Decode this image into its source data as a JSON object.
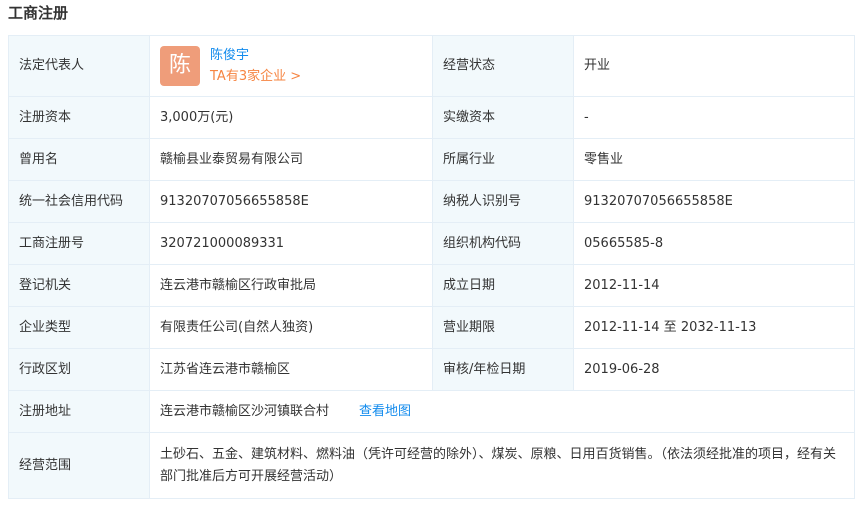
{
  "section": {
    "title": "工商注册"
  },
  "legal_rep": {
    "label": "法定代表人",
    "avatar_char": "陈",
    "name": "陈俊宇",
    "company_count": "TA有3家企业 >"
  },
  "status": {
    "label": "经营状态",
    "value": "开业"
  },
  "rows": [
    {
      "l1": "注册资本",
      "v1": "3,000万(元)",
      "l2": "实缴资本",
      "v2": "-"
    },
    {
      "l1": "曾用名",
      "v1": "赣榆县业泰贸易有限公司",
      "l2": "所属行业",
      "v2": "零售业"
    },
    {
      "l1": "统一社会信用代码",
      "v1": "91320707056655858E",
      "l2": "纳税人识别号",
      "v2": "91320707056655858E"
    },
    {
      "l1": "工商注册号",
      "v1": "320721000089331",
      "l2": "组织机构代码",
      "v2": "05665585-8"
    },
    {
      "l1": "登记机关",
      "v1": "连云港市赣榆区行政审批局",
      "l2": "成立日期",
      "v2": "2012-11-14"
    },
    {
      "l1": "企业类型",
      "v1": "有限责任公司(自然人独资)",
      "l2": "营业期限",
      "v2": "2012-11-14 至 2032-11-13"
    },
    {
      "l1": "行政区划",
      "v1": "江苏省连云港市赣榆区",
      "l2": "审核/年检日期",
      "v2": "2019-06-28"
    }
  ],
  "address": {
    "label": "注册地址",
    "value": "连云港市赣榆区沙河镇联合村",
    "map_link": "查看地图"
  },
  "scope": {
    "label": "经营范围",
    "value": "土砂石、五金、建筑材料、燃料油（凭许可经营的除外）、煤炭、原粮、日用百货销售。（依法须经批准的项目，经有关部门批准后方可开展经营活动）"
  },
  "colors": {
    "label_bg": "#f2f9fc",
    "border": "#e4eef6",
    "link": "#128bed",
    "accent_orange": "#f68542",
    "avatar_bg": "#ef9d7a"
  }
}
